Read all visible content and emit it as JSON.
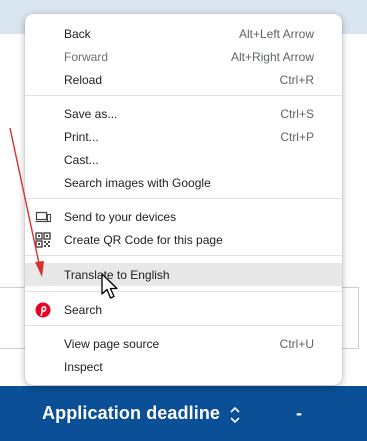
{
  "menu": {
    "items": [
      {
        "label": "Back",
        "shortcut": "Alt+Left Arrow"
      },
      {
        "label": "Forward",
        "shortcut": "Alt+Right Arrow"
      },
      {
        "label": "Reload",
        "shortcut": "Ctrl+R"
      },
      {
        "label": "Save as...",
        "shortcut": "Ctrl+S"
      },
      {
        "label": "Print...",
        "shortcut": "Ctrl+P"
      },
      {
        "label": "Cast...",
        "shortcut": ""
      },
      {
        "label": "Search images with Google",
        "shortcut": ""
      },
      {
        "label": "Send to your devices",
        "shortcut": "",
        "icon": "devices-icon"
      },
      {
        "label": "Create QR Code for this page",
        "shortcut": "",
        "icon": "qr-code-icon"
      },
      {
        "label": "Translate to English",
        "shortcut": ""
      },
      {
        "label": "Search",
        "shortcut": "",
        "icon": "pinterest-icon"
      },
      {
        "label": "View page source",
        "shortcut": "Ctrl+U"
      },
      {
        "label": "Inspect",
        "shortcut": ""
      }
    ]
  },
  "page": {
    "deadline_label": "Application deadline",
    "dash": "-"
  },
  "colors": {
    "bottom_bar": "#0b4f96",
    "hover": "#e8e8e8",
    "annotation_arrow": "#d9312b",
    "pinterest": "#e60023"
  }
}
